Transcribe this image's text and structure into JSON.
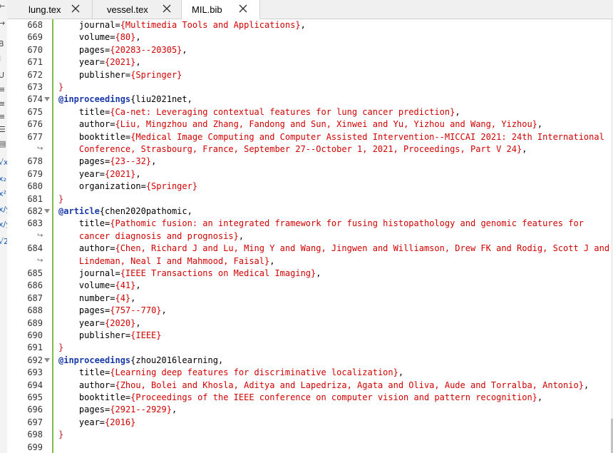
{
  "tabs": [
    {
      "label": "lung.tex",
      "active": false
    },
    {
      "label": "vessel.tex",
      "active": false
    },
    {
      "label": "MIL.bib",
      "active": true
    }
  ],
  "toolbar_glyphs": [
    "←",
    "→",
    "B",
    "I",
    "U",
    "≡",
    "≡",
    "≡",
    "☰",
    "▤",
    "√x",
    "x₂",
    "x²",
    "x/y",
    "x/y",
    "√2"
  ],
  "colors": {
    "keyword": "#1a3aa8",
    "value": "#d10000",
    "change_bar": "#7dc14a"
  },
  "lines": [
    {
      "n": "668",
      "key": "journal=",
      "val": "{Multimedia Tools and Applications}",
      "tail": ","
    },
    {
      "n": "669",
      "key": "volume=",
      "val": "{80}",
      "tail": ","
    },
    {
      "n": "670",
      "key": "pages=",
      "val": "{20283--20305}",
      "tail": ","
    },
    {
      "n": "671",
      "key": "year=",
      "val": "{2021}",
      "tail": ","
    },
    {
      "n": "672",
      "key": "publisher=",
      "val": "{Springer}",
      "tail": ""
    },
    {
      "n": "673",
      "close": "}"
    },
    {
      "n": "674",
      "entry": "@inproceedings",
      "cite": "{liu2021net,",
      "fold": true
    },
    {
      "n": "675",
      "key": "title=",
      "val": "{Ca-net: Leveraging contextual features for lung cancer prediction}",
      "tail": ","
    },
    {
      "n": "676",
      "key": "author=",
      "val": "{Liu, Mingzhou and Zhang, Fandong and Sun, Xinwei and Yu, Yizhou and Wang, Yizhou}",
      "tail": ","
    },
    {
      "n": "677",
      "key": "booktitle=",
      "val": "{Medical Image Computing and Computer Assisted Intervention--MICCAI 2021: 24th International",
      "tail": ""
    },
    {
      "n": "",
      "wrap": true,
      "val": "Conference, Strasbourg, France, September 27--October 1, 2021, Proceedings, Part V 24}",
      "tail": ","
    },
    {
      "n": "678",
      "key": "pages=",
      "val": "{23--32}",
      "tail": ","
    },
    {
      "n": "679",
      "key": "year=",
      "val": "{2021}",
      "tail": ","
    },
    {
      "n": "680",
      "key": "organization=",
      "val": "{Springer}",
      "tail": ""
    },
    {
      "n": "681",
      "close": "}"
    },
    {
      "n": "682",
      "entry": "@article",
      "cite": "{chen2020pathomic,",
      "fold": true
    },
    {
      "n": "683",
      "key": "title=",
      "val": "{Pathomic fusion: an integrated framework for fusing histopathology and genomic features for",
      "tail": ""
    },
    {
      "n": "",
      "wrap": true,
      "val": "cancer diagnosis and prognosis}",
      "tail": ","
    },
    {
      "n": "684",
      "key": "author=",
      "val": "{Chen, Richard J and Lu, Ming Y and Wang, Jingwen and Williamson, Drew FK and Rodig, Scott J and",
      "tail": ""
    },
    {
      "n": "",
      "wrap": true,
      "val": "Lindeman, Neal I and Mahmood, Faisal}",
      "tail": ","
    },
    {
      "n": "685",
      "key": "journal=",
      "val": "{IEEE Transactions on Medical Imaging}",
      "tail": ","
    },
    {
      "n": "686",
      "key": "volume=",
      "val": "{41}",
      "tail": ","
    },
    {
      "n": "687",
      "key": "number=",
      "val": "{4}",
      "tail": ","
    },
    {
      "n": "688",
      "key": "pages=",
      "val": "{757--770}",
      "tail": ","
    },
    {
      "n": "689",
      "key": "year=",
      "val": "{2020}",
      "tail": ","
    },
    {
      "n": "690",
      "key": "publisher=",
      "val": "{IEEE}",
      "tail": ""
    },
    {
      "n": "691",
      "close": "}"
    },
    {
      "n": "692",
      "entry": "@inproceedings",
      "cite": "{zhou2016learning,",
      "fold": true
    },
    {
      "n": "693",
      "key": "title=",
      "val": "{Learning deep features for discriminative localization}",
      "tail": ","
    },
    {
      "n": "694",
      "key": "author=",
      "val": "{Zhou, Bolei and Khosla, Aditya and Lapedriza, Agata and Oliva, Aude and Torralba, Antonio}",
      "tail": ","
    },
    {
      "n": "695",
      "key": "booktitle=",
      "val": "{Proceedings of the IEEE conference on computer vision and pattern recognition}",
      "tail": ","
    },
    {
      "n": "696",
      "key": "pages=",
      "val": "{2921--2929}",
      "tail": ","
    },
    {
      "n": "697",
      "key": "year=",
      "val": "{2016}",
      "tail": ""
    },
    {
      "n": "698",
      "close": "}"
    },
    {
      "n": "699",
      "empty": true
    }
  ]
}
